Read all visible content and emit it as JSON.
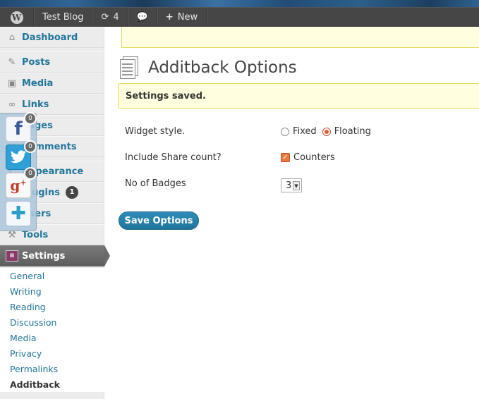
{
  "adminbar": {
    "site_name": "Test Blog",
    "updates_count": "4",
    "new_label": "New"
  },
  "sidebar": {
    "items": [
      {
        "label": "Dashboard",
        "icon": "home-icon"
      },
      {
        "label": "Posts",
        "icon": "pin-icon"
      },
      {
        "label": "Media",
        "icon": "media-icon"
      },
      {
        "label": "Links",
        "icon": "link-icon"
      },
      {
        "label": "Pages",
        "icon": "pages-icon"
      },
      {
        "label": "Comments",
        "icon": "comments-icon"
      },
      {
        "label": "Appearance",
        "icon": "appearance-icon"
      },
      {
        "label": "Plugins",
        "icon": "plugins-icon",
        "badge": "1"
      },
      {
        "label": "Users",
        "icon": "users-icon"
      },
      {
        "label": "Tools",
        "icon": "tools-icon"
      }
    ],
    "settings_label": "Settings",
    "submenu": [
      "General",
      "Writing",
      "Reading",
      "Discussion",
      "Media",
      "Privacy",
      "Permalinks",
      "Additback"
    ]
  },
  "share": {
    "facebook_count": "0",
    "twitter_count": "0",
    "gplus_count": "0"
  },
  "main": {
    "title": "Additback Options",
    "notice": "Settings saved.",
    "widget_style_label": "Widget style.",
    "fixed_label": "Fixed",
    "floating_label": "Floating",
    "share_count_label": "Include Share count?",
    "counters_label": "Counters",
    "badges_label": "No of Badges",
    "badges_value": "3",
    "save_button": "Save Options"
  }
}
